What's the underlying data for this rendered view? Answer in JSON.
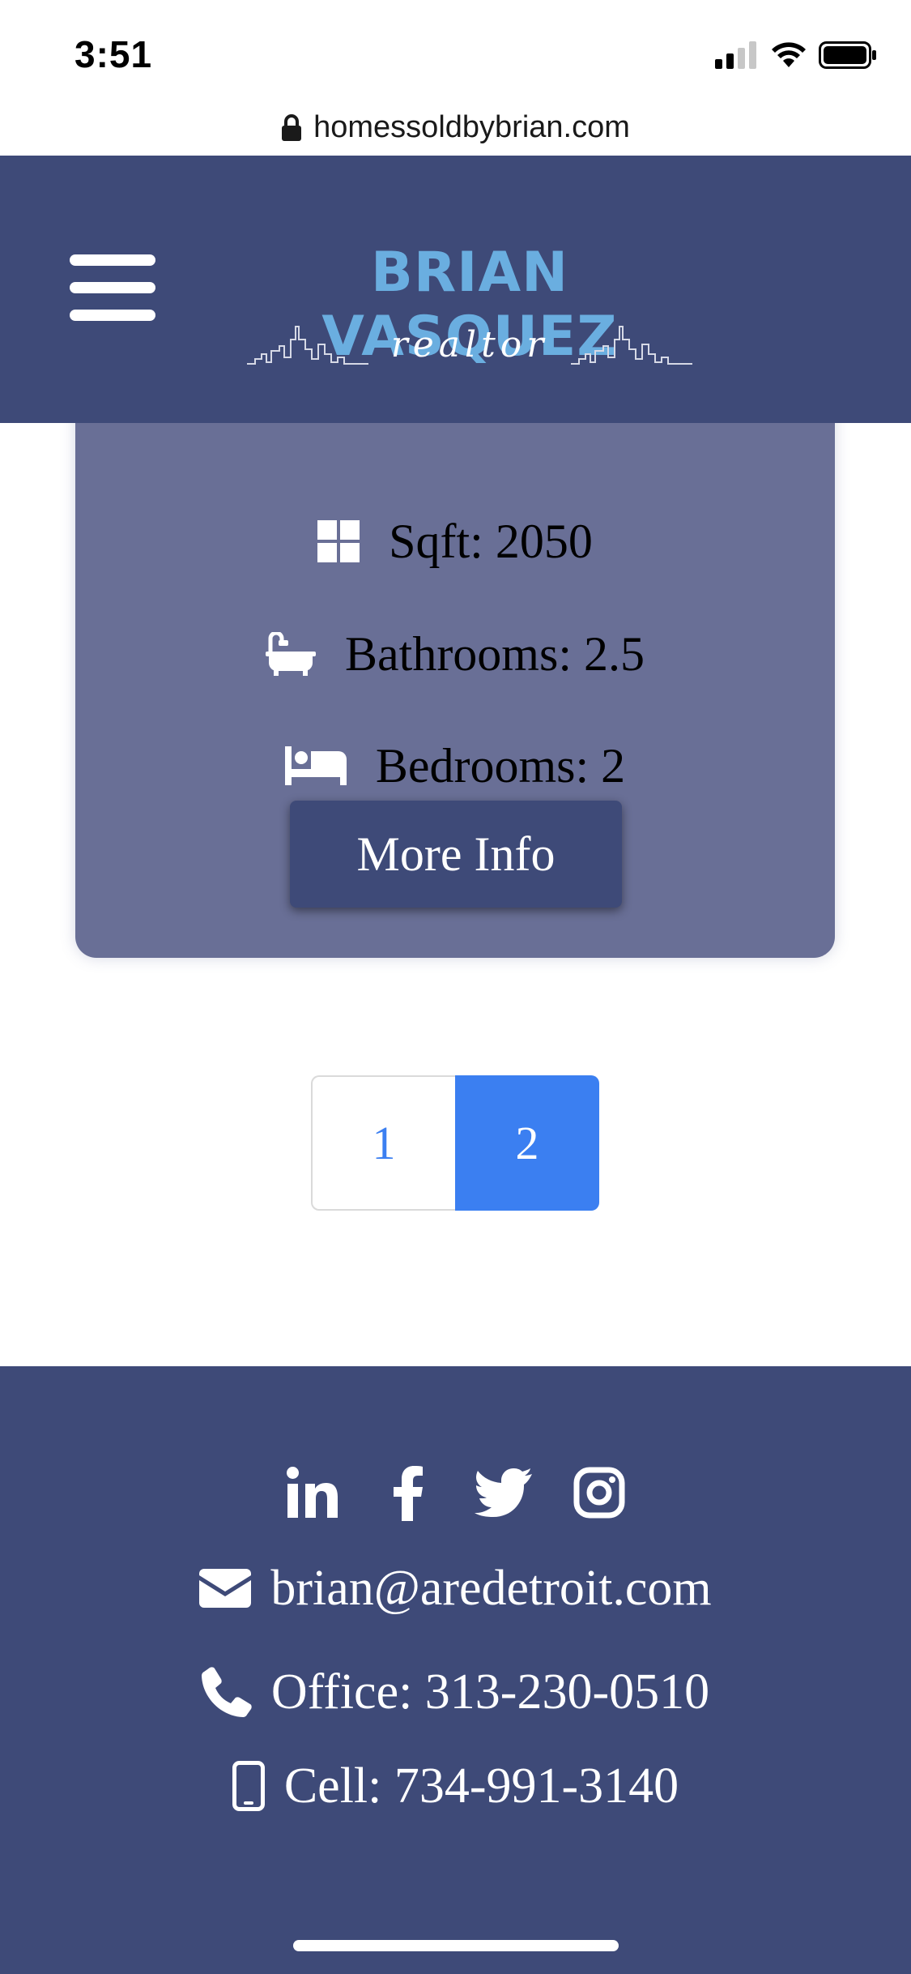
{
  "status_bar": {
    "time": "3:51"
  },
  "browser": {
    "url": "homessoldbybrian.com"
  },
  "header": {
    "logo_name": "BRIAN VASQUEZ",
    "logo_tagline": "realtor"
  },
  "listing": {
    "sqft": "Sqft: 2050",
    "bathrooms": "Bathrooms: 2.5",
    "bedrooms": "Bedrooms: 2",
    "more_info": "More Info"
  },
  "pagination": {
    "pages": [
      "1",
      "2"
    ],
    "active": "2"
  },
  "footer": {
    "email": "brian@aredetroit.com",
    "office": "Office: 313-230-0510",
    "cell": "Cell: 734-991-3140"
  },
  "colors": {
    "brand": "#3e4a78",
    "card": "#696f96",
    "logo_blue": "#6aaee0",
    "link_blue": "#3b7ff1"
  },
  "icons": {
    "sqft": "windows-grid-icon",
    "bathrooms": "bathtub-icon",
    "bedrooms": "bed-icon",
    "email": "envelope-icon",
    "office": "phone-icon",
    "cell": "mobile-phone-icon",
    "social": [
      "linkedin-icon",
      "facebook-icon",
      "twitter-icon",
      "instagram-icon"
    ]
  }
}
